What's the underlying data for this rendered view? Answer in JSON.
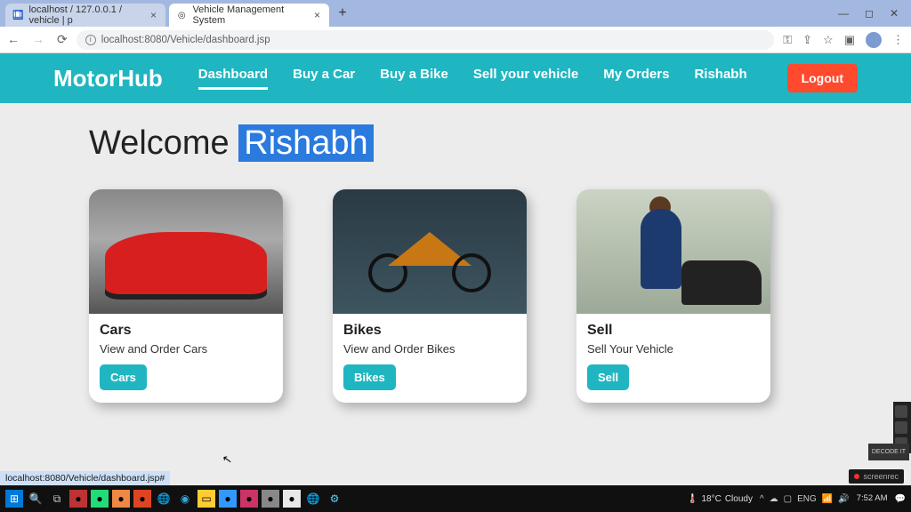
{
  "browser": {
    "tabs": [
      {
        "favicon": "🛄",
        "title": "localhost / 127.0.0.1 / vehicle | p"
      },
      {
        "favicon": "◎",
        "title": "Vehicle Management System"
      }
    ],
    "url": "localhost:8080/Vehicle/dashboard.jsp",
    "status_url": "localhost:8080/Vehicle/dashboard.jsp#"
  },
  "nav": {
    "brand": "MotorHub",
    "links": [
      "Dashboard",
      "Buy a Car",
      "Buy a Bike",
      "Sell your vehicle",
      "My Orders",
      "Rishabh"
    ],
    "active_index": 0,
    "logout": "Logout"
  },
  "welcome": {
    "prefix": "Welcome ",
    "name": "Rishabh"
  },
  "cards": [
    {
      "title": "Cars",
      "desc": "View and Order Cars",
      "button": "Cars"
    },
    {
      "title": "Bikes",
      "desc": "View and Order Bikes",
      "button": "Bikes"
    },
    {
      "title": "Sell",
      "desc": "Sell Your Vehicle",
      "button": "Sell"
    }
  ],
  "taskbar": {
    "weather_temp": "18°C",
    "weather_desc": "Cloudy",
    "time": "7:52 AM",
    "recorder": "screenrec",
    "badge": "DECODE IT"
  }
}
